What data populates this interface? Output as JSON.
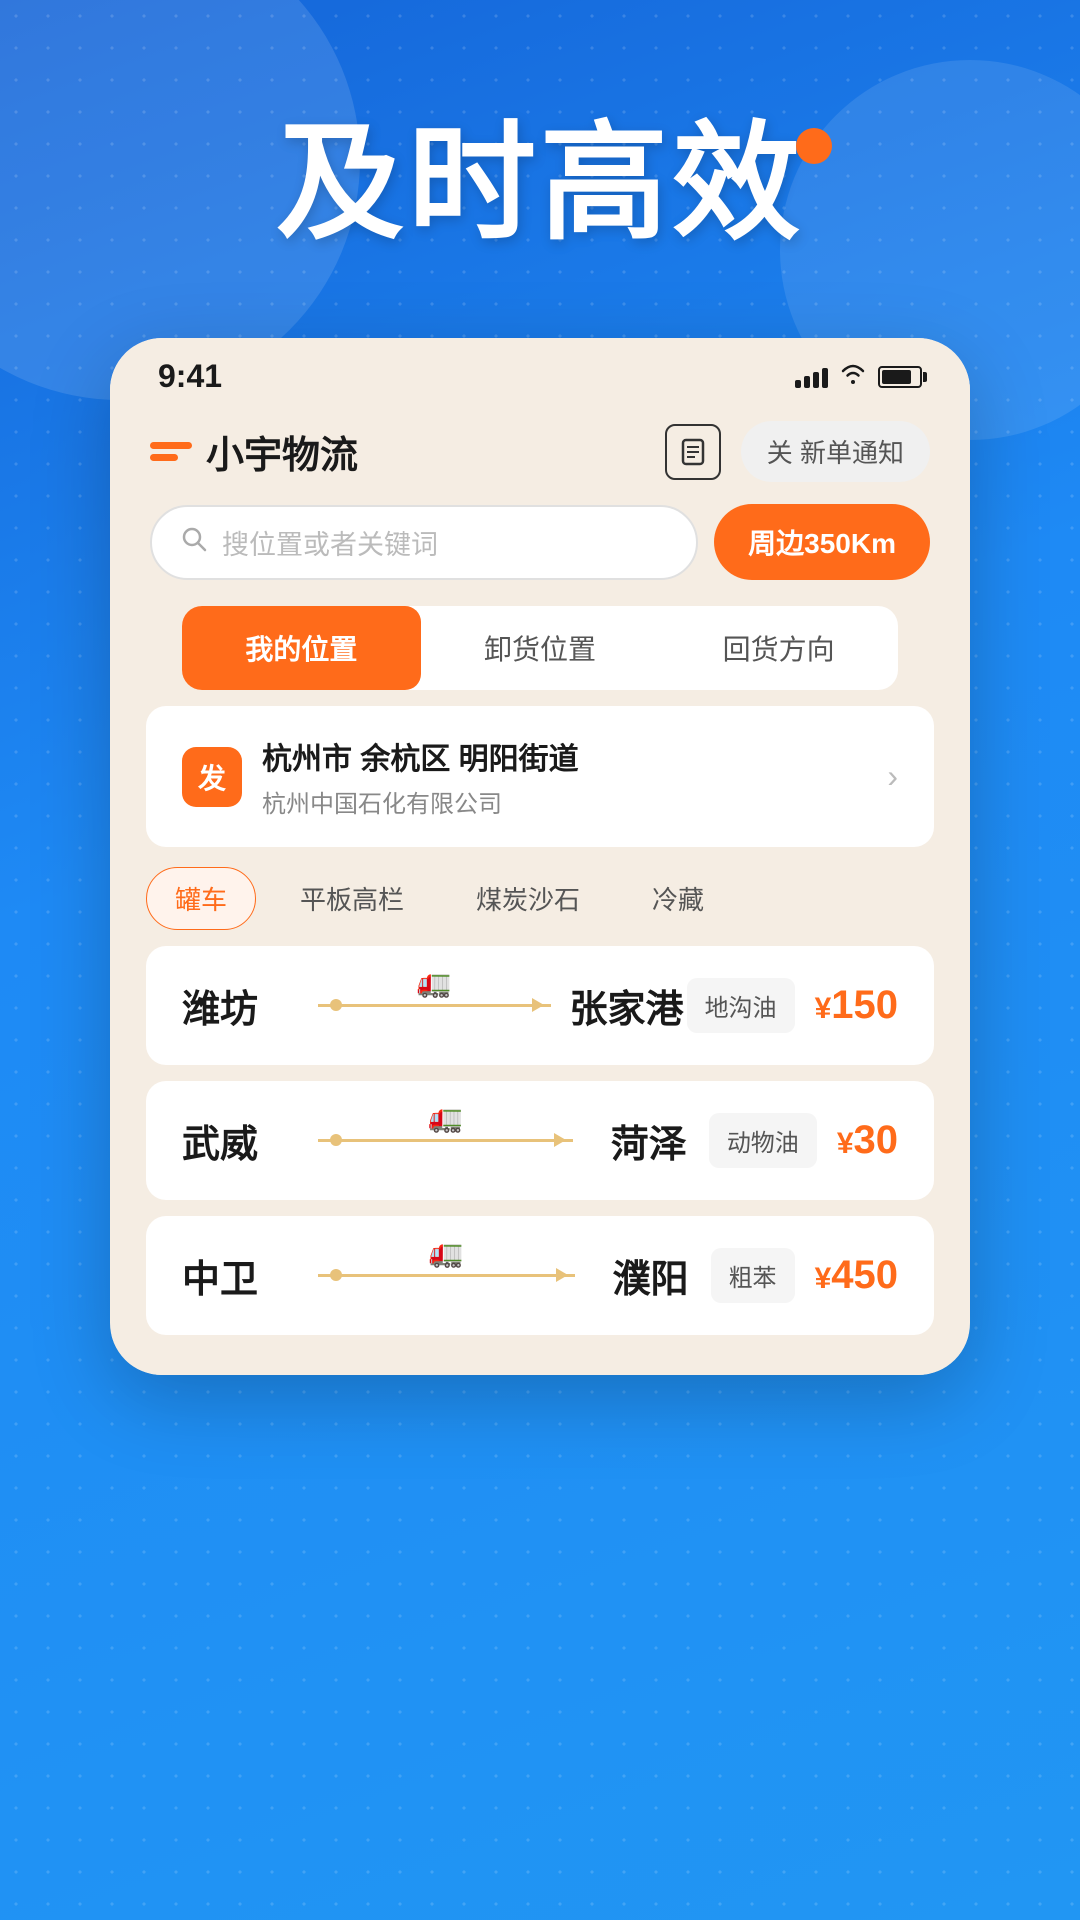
{
  "app": {
    "name": "小宇物流",
    "logo": {
      "line_long": "发",
      "alt": "Logo"
    }
  },
  "hero": {
    "title": "及时高效"
  },
  "status_bar": {
    "time": "9:41",
    "signal_bars": [
      8,
      12,
      16,
      20,
      22
    ],
    "wifi": "WiFi",
    "battery": "Battery"
  },
  "header": {
    "doc_icon": "📋",
    "notification_label": "关 新单通知"
  },
  "search": {
    "placeholder": "搜位置或者关键词",
    "nearby_btn": "周边350Km"
  },
  "tabs": [
    {
      "label": "我的位置",
      "active": true
    },
    {
      "label": "卸货位置",
      "active": false
    },
    {
      "label": "回货方向",
      "active": false
    }
  ],
  "location": {
    "badge": "发",
    "main": "杭州市 余杭区 明阳街道",
    "sub": "杭州中国石化有限公司"
  },
  "tags": [
    {
      "label": "罐车",
      "active": true
    },
    {
      "label": "平板高栏",
      "active": false
    },
    {
      "label": "煤炭沙石",
      "active": false
    },
    {
      "label": "冷藏",
      "active": false
    }
  ],
  "freight_list": [
    {
      "from": "潍坊",
      "to": "张家港",
      "badge": "地沟油",
      "price": "150",
      "symbol": "¥"
    },
    {
      "from": "武威",
      "to": "菏泽",
      "badge": "动物油",
      "price": "30",
      "symbol": "¥"
    },
    {
      "from": "中卫",
      "to": "濮阳",
      "badge": "粗苯",
      "price": "450",
      "symbol": "¥"
    }
  ],
  "colors": {
    "orange": "#ff6b1a",
    "blue_bg": "#1a7fe8",
    "card_bg": "#f5ede3",
    "white": "#ffffff"
  }
}
